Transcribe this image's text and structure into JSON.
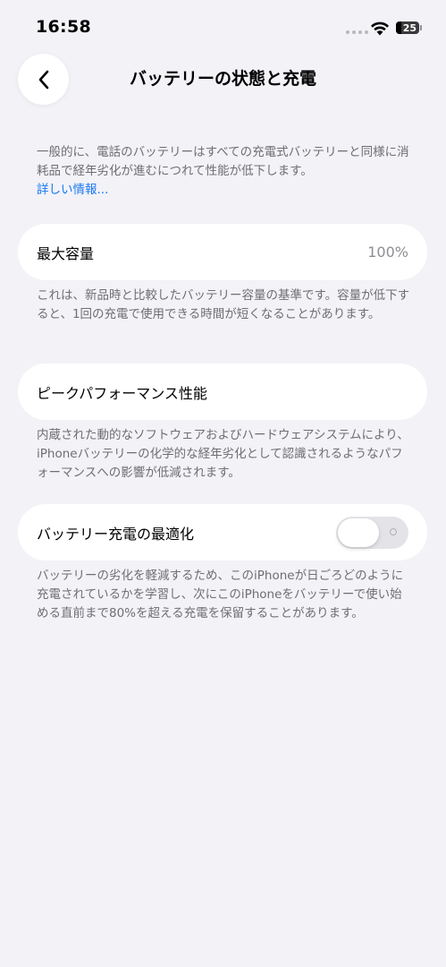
{
  "status_bar": {
    "time": "16:58",
    "battery_level": "25",
    "icons": [
      "signal-dots-icon",
      "wifi-icon",
      "battery-icon"
    ]
  },
  "nav": {
    "back_icon": "chevron-left-icon",
    "title": "バッテリーの状態と充電"
  },
  "intro": {
    "text": "一般的に、電話のバッテリーはすべての充電式バッテリーと同様に消耗品で経年劣化が進むにつれて性能が低下します。",
    "link": "詳しい情報..."
  },
  "max_capacity": {
    "label": "最大容量",
    "value": "100%",
    "footnote": "これは、新品時と比較したバッテリー容量の基準です。容量が低下すると、1回の充電で使用できる時間が短くなることがあります。"
  },
  "peak_performance": {
    "label": "ピークパフォーマンス性能",
    "footnote": "内蔵された動的なソフトウェアおよびハードウェアシステムにより、iPhoneバッテリーの化学的な経年劣化として認識されるようなパフォーマンスへの影響が低減されます。"
  },
  "optimized_charging": {
    "label": "バッテリー充電の最適化",
    "toggle_on": false,
    "footnote": "バッテリーの劣化を軽減するため、このiPhoneが日ごろどのように充電されているかを学習し、次にこのiPhoneをバッテリーで使い始める直前まで80%を超える充電を保留することがあります。"
  },
  "colors": {
    "background": "#f2f2f7",
    "cell": "#ffffff",
    "link": "#1877f2",
    "secondary_text": "#6e6e73",
    "toggle_off": "#e3e3e8"
  }
}
